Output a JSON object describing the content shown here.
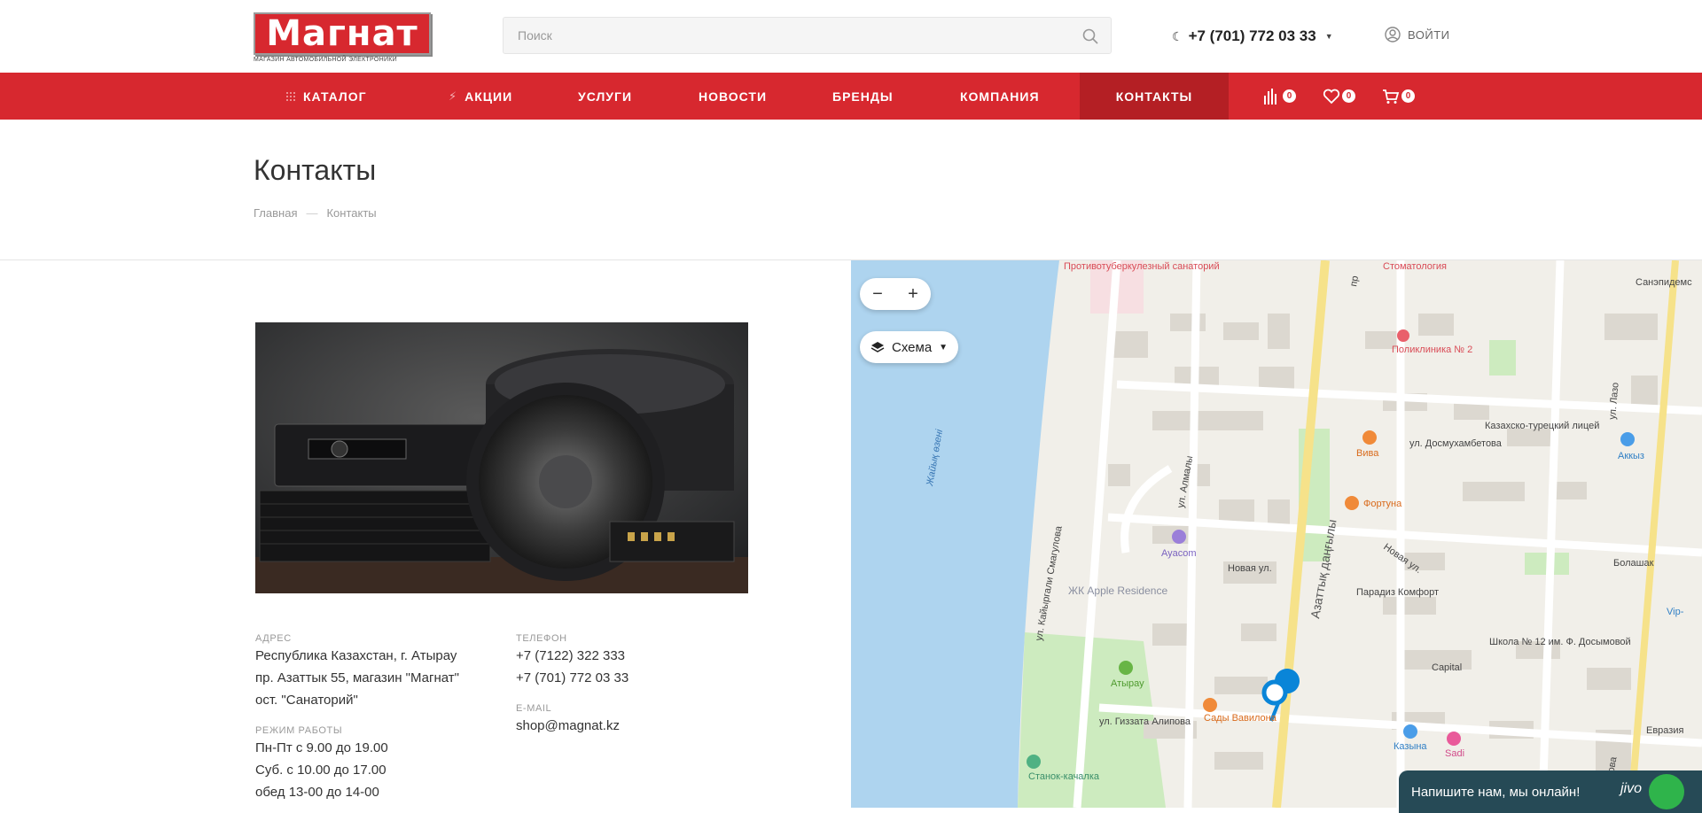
{
  "header": {
    "logo_text": "Магнат",
    "logo_subtitle": "МАГАЗИН АВТОМОБИЛЬНОЙ ЭЛЕКТРОНИКИ",
    "search_placeholder": "Поиск",
    "phone": "+7 (701) 772 03 33",
    "login_label": "ВОЙТИ"
  },
  "nav": {
    "items": [
      {
        "label": "КАТАЛОГ",
        "icon": "grid-icon"
      },
      {
        "label": "АКЦИИ",
        "icon": "lightning-icon"
      },
      {
        "label": "УСЛУГИ"
      },
      {
        "label": "НОВОСТИ"
      },
      {
        "label": "БРЕНДЫ"
      },
      {
        "label": "КОМПАНИЯ"
      },
      {
        "label": "КОНТАКТЫ",
        "active": true
      }
    ],
    "compare_count": "0",
    "favorites_count": "0",
    "cart_count": "0"
  },
  "page": {
    "title": "Контакты",
    "breadcrumb": [
      "Главная",
      "—",
      "Контакты"
    ]
  },
  "contacts": {
    "address_label": "АДРЕС",
    "address_lines": [
      "Республика Казахстан, г. Атырау",
      "пр. Азаттык 55, магазин \"Магнат\"",
      "ост. \"Санаторий\""
    ],
    "hours_label": "РЕЖИМ РАБОТЫ",
    "hours_lines": [
      "Пн-Пт с 9.00 до 19.00",
      "Суб. с 10.00 до 17.00",
      "обед 13-00 до 14-00"
    ],
    "phone_label": "ТЕЛЕФОН",
    "phones": [
      "+7 (7122) 322 333",
      "+7 (701) 772 03 33"
    ],
    "email_label": "E-MAIL",
    "email": "shop@magnat.kz"
  },
  "map": {
    "zoom_out": "−",
    "zoom_in": "+",
    "layer_label": "Схема",
    "labels": {
      "sanatorium": "Противотуберкулезный санаторий",
      "stomatology": "Стоматология",
      "polyclinic": "Поликлиника № 2",
      "sanepid": "Санэпидемс",
      "river": "Жайық өзені",
      "street_dosmukh": "ул. Досмухамбетова",
      "lyceum": "Казахско-турецкий лицей",
      "akkys": "Аккыз",
      "viva": "Вива",
      "fortuna": "Фортуна",
      "almaly": "ул. Алмалы",
      "ayacom": "Ayacom",
      "novaya": "Новая ул.",
      "novaya2": "Новая ул.",
      "bolashak": "Болашак",
      "apple": "ЖК Apple Residence",
      "paradiz": "Парадиз Комфорт",
      "kaiyrgali": "ул. Кайыргали Смагулова",
      "azattyk": "Азаттық даңғылы",
      "school": "Школа № 12 им. Ф. Досымовой",
      "capital": "Capital",
      "atyrau": "Атырау",
      "gizzata": "ул. Гиззата Алипова",
      "sady": "Сады Вавилона",
      "kazyna": "Казына",
      "sadi": "Sadi",
      "evrazia": "Евразия",
      "stanok": "Станок-качалка",
      "vip": "Vip-",
      "lazo": "ул. Лазо",
      "temisova": "Темисова",
      "pro": "пр"
    }
  },
  "chat": {
    "text": "Напишите нам, мы онлайн!",
    "brand": "jivo"
  }
}
